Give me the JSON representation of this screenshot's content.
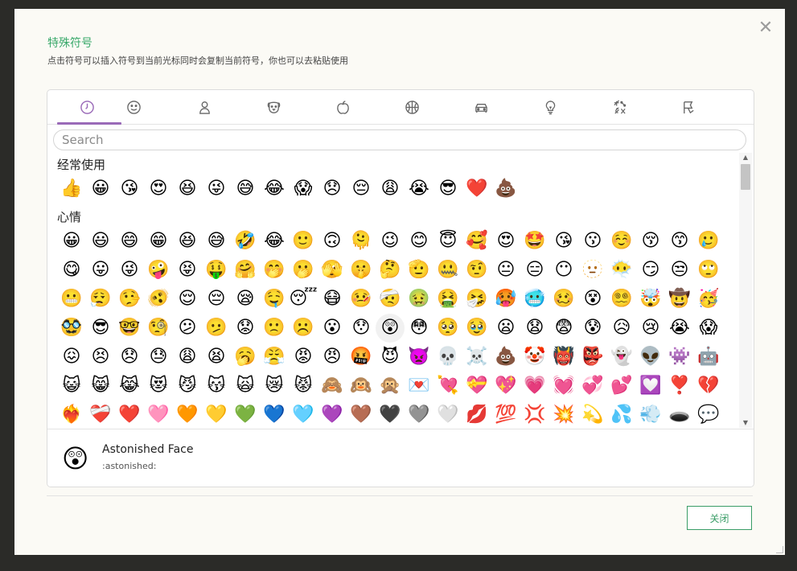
{
  "dialog": {
    "title": "特殊符号",
    "subtitle": "点击符号可以插入符号到当前光标同时会复制当前符号，你也可以去粘贴使用",
    "close_icon": "close-icon",
    "close_glyph": "✕"
  },
  "tabs": [
    {
      "name": "recent",
      "icon": "clock-icon",
      "active": true
    },
    {
      "name": "smileys",
      "icon": "smiley-icon",
      "active": false
    },
    {
      "name": "people",
      "icon": "person-icon",
      "active": false
    },
    {
      "name": "animals",
      "icon": "dog-icon",
      "active": false
    },
    {
      "name": "food",
      "icon": "apple-icon",
      "active": false
    },
    {
      "name": "activity",
      "icon": "basketball-icon",
      "active": false
    },
    {
      "name": "travel",
      "icon": "car-icon",
      "active": false
    },
    {
      "name": "objects",
      "icon": "lightbulb-icon",
      "active": false
    },
    {
      "name": "symbols",
      "icon": "symbols-icon",
      "active": false
    },
    {
      "name": "flags",
      "icon": "flag-icon",
      "active": false
    }
  ],
  "search": {
    "placeholder": "Search",
    "value": ""
  },
  "categories": [
    {
      "label": "经常使用",
      "emojis": [
        "👍",
        "😀",
        "😘",
        "😍",
        "😆",
        "😜",
        "😅",
        "😂",
        "😱",
        "😞",
        "😔",
        "😩",
        "😭",
        "😎",
        "❤️",
        "💩"
      ]
    },
    {
      "label": "心情",
      "emojis": [
        "😀",
        "😃",
        "😄",
        "😁",
        "😆",
        "😅",
        "🤣",
        "😂",
        "🙂",
        "🙃",
        "🫠",
        "😉",
        "😊",
        "😇",
        "🥰",
        "😍",
        "🤩",
        "😘",
        "😗",
        "☺️",
        "😚",
        "😙",
        "🥲",
        "😋",
        "😛",
        "😜",
        "🤪",
        "😝",
        "🤑",
        "🤗",
        "🤭",
        "🫢",
        "🫣",
        "🤫",
        "🤔",
        "🫡",
        "🤐",
        "🤨",
        "😐",
        "😑",
        "😶",
        "🫥",
        "😶‍🌫️",
        "😏",
        "😒",
        "🙄",
        "😬",
        "😮‍💨",
        "🤥",
        "🫨",
        "😌",
        "😔",
        "😪",
        "🤤",
        "😴",
        "😷",
        "🤒",
        "🤕",
        "🤢",
        "🤮",
        "🤧",
        "🥵",
        "🥶",
        "🥴",
        "😵",
        "😵‍💫",
        "🤯",
        "🤠",
        "🥳",
        "🥸",
        "😎",
        "🤓",
        "🧐",
        "😕",
        "🫤",
        "😟",
        "🙁",
        "☹️",
        "😮",
        "😯",
        "😲",
        "😳",
        "🥺",
        "🥹",
        "😦",
        "😧",
        "😨",
        "😰",
        "😥",
        "😢",
        "😭",
        "😱",
        "😖",
        "😣",
        "😞",
        "😓",
        "😩",
        "😫",
        "🥱",
        "😤",
        "😡",
        "😠",
        "🤬",
        "😈",
        "👿",
        "💀",
        "☠️",
        "💩",
        "🤡",
        "👹",
        "👺",
        "👻",
        "👽",
        "👾",
        "🤖",
        "😺",
        "😸",
        "😹",
        "😻",
        "😼",
        "😽",
        "🙀",
        "😿",
        "😾",
        "🙈",
        "🙉",
        "🙊",
        "💌",
        "💘",
        "💝",
        "💖",
        "💗",
        "💓",
        "💞",
        "💕",
        "💟",
        "❣️",
        "💔",
        "❤️‍🔥",
        "❤️‍🩹",
        "❤️",
        "🩷",
        "🧡",
        "💛",
        "💚",
        "💙",
        "🩵",
        "💜",
        "🤎",
        "🖤",
        "🩶",
        "🤍",
        "💋",
        "💯",
        "💢",
        "💥",
        "💫",
        "💦",
        "💨",
        "🕳️",
        "💬"
      ]
    }
  ],
  "selected_index": {
    "category": 1,
    "emoji": 80
  },
  "preview": {
    "emoji": "😲",
    "name": "Astonished Face",
    "code": ":astonished:"
  },
  "scroll": {
    "up_glyph": "▲",
    "down_glyph": "▼"
  },
  "footer": {
    "close_button_label": "关闭"
  },
  "colors": {
    "accent": "#3aa96b",
    "tab_indicator": "#9a6ab8"
  }
}
